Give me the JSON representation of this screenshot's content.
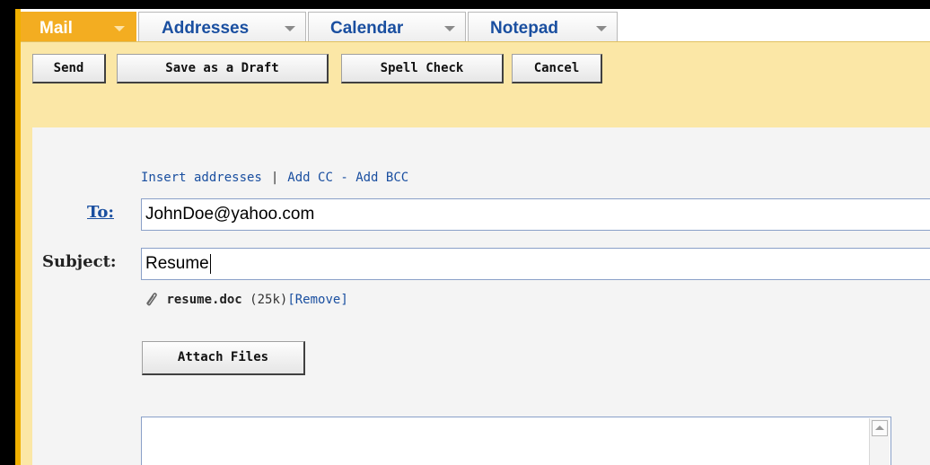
{
  "tabs": [
    {
      "label": "Mail",
      "active": true
    },
    {
      "label": "Addresses",
      "active": false
    },
    {
      "label": "Calendar",
      "active": false
    },
    {
      "label": "Notepad",
      "active": false
    }
  ],
  "toolbar": {
    "send_label": "Send",
    "draft_label": "Save as a Draft",
    "spell_label": "Spell Check",
    "cancel_label": "Cancel"
  },
  "compose": {
    "insert_addresses": "Insert addresses",
    "separator": "|",
    "add_cc": "Add CC",
    "dash": "-",
    "add_bcc": "Add BCC",
    "to_label": "To:",
    "to_value": "JohnDoe@yahoo.com",
    "subject_label": "Subject:",
    "subject_value": "Resume",
    "attachment": {
      "name": "resume.doc",
      "size": "(25k)",
      "remove": "[Remove]"
    },
    "attach_button": "Attach Files"
  },
  "colors": {
    "accent_orange": "#f3ad21",
    "toolbar_bg": "#fbe7a6",
    "link_blue": "#1a4fa0"
  },
  "icons": {
    "attachment": "paperclip-icon",
    "tab_dropdown": "chevron-down-icon",
    "scroll_up": "scroll-up-arrow-icon"
  }
}
